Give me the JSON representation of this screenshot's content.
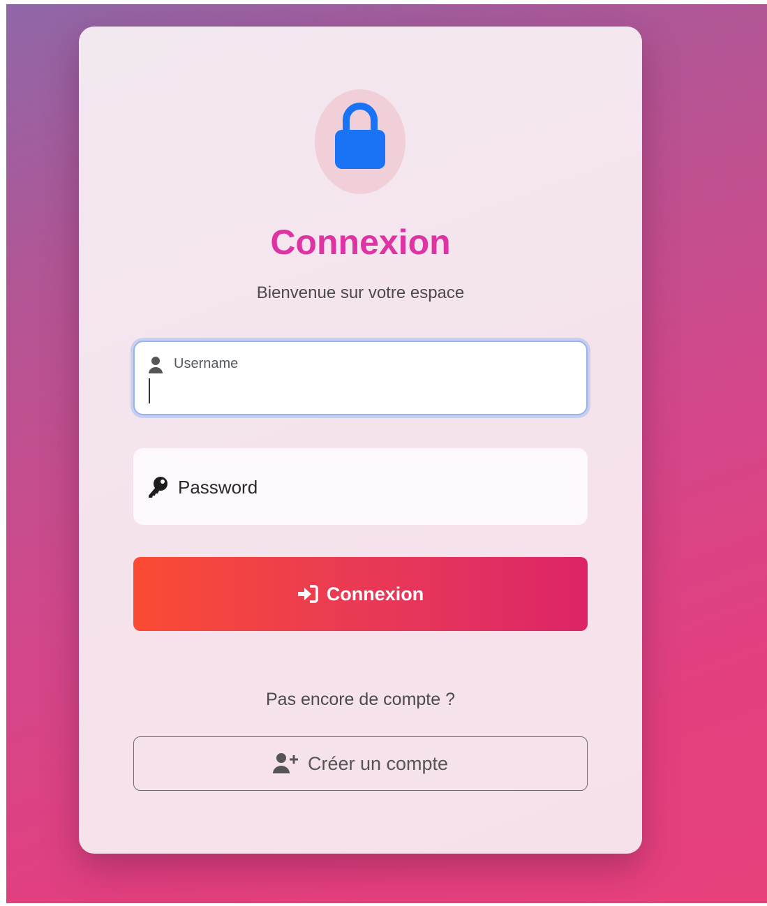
{
  "colors": {
    "title": "#dd33a3",
    "lock": "#1a73f5",
    "button_gradient_start": "#fb4b33",
    "button_gradient_end": "#dc2467"
  },
  "header": {
    "icon": "lock-icon",
    "title": "Connexion",
    "subtitle": "Bienvenue sur votre espace"
  },
  "form": {
    "username": {
      "icon": "user-icon",
      "label": "Username",
      "value": ""
    },
    "password": {
      "icon": "key-icon",
      "placeholder": "Password",
      "value": ""
    },
    "submit": {
      "icon": "sign-in-icon",
      "label": "Connexion"
    }
  },
  "footer": {
    "prompt": "Pas encore de compte ?",
    "register": {
      "icon": "user-plus-icon",
      "label": "Créer un compte"
    }
  }
}
